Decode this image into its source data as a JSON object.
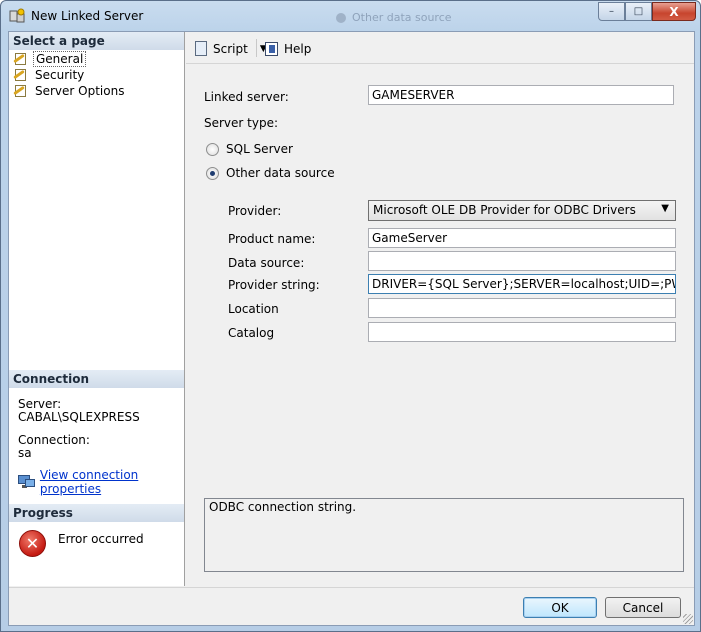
{
  "window": {
    "title": "New Linked Server",
    "background_hint": "Other data source",
    "controls": {
      "minimize": "–",
      "maximize": "□",
      "close": "X"
    }
  },
  "left": {
    "select_page_header": "Select a page",
    "pages": [
      {
        "label": "General",
        "icon": "page-wrench-icon",
        "selected": true
      },
      {
        "label": "Security",
        "icon": "page-wrench-icon",
        "selected": false
      },
      {
        "label": "Server Options",
        "icon": "page-wrench-icon",
        "selected": false
      }
    ],
    "connection_header": "Connection",
    "server_label": "Server:",
    "server_value": "CABAL\\SQLEXPRESS",
    "connection_label": "Connection:",
    "connection_value": "sa",
    "view_props_link": "View connection properties",
    "progress_header": "Progress",
    "progress_status": "Error occurred"
  },
  "toolbar": {
    "script_label": "Script",
    "help_label": "Help"
  },
  "form": {
    "linked_server_label": "Linked server:",
    "linked_server_value": "GAMESERVER",
    "server_type_label": "Server type:",
    "sql_server_radio": "SQL Server",
    "other_source_radio": "Other data source",
    "selected_type": "Other data source",
    "provider_label": "Provider:",
    "provider_value": "Microsoft OLE DB Provider for ODBC Drivers",
    "product_name_label": "Product name:",
    "product_name_value": "GameServer",
    "data_source_label": "Data source:",
    "data_source_value": "",
    "provider_string_label": "Provider string:",
    "provider_string_value": "DRIVER={SQL Server};SERVER=localhost;UID=;PWD=;",
    "location_label": "Location",
    "location_value": "",
    "catalog_label": "Catalog",
    "catalog_value": ""
  },
  "description": "ODBC connection string.",
  "footer": {
    "ok_label": "OK",
    "cancel_label": "Cancel"
  },
  "colors": {
    "link": "#0033cc",
    "error": "#c51a12",
    "title_bar": "#bcd3ea"
  }
}
